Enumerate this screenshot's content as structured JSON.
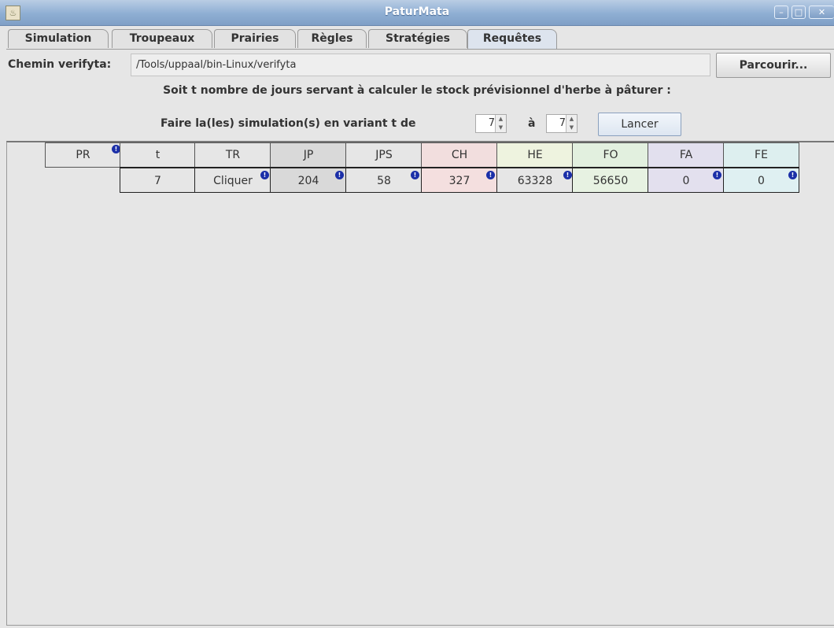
{
  "window": {
    "title": "PaturMata"
  },
  "tabs": [
    "Simulation",
    "Troupeaux",
    "Prairies",
    "Règles",
    "Stratégies",
    "Requêtes"
  ],
  "path": {
    "label": "Chemin verifyta:",
    "value": "/Tools/uppaal/bin-Linux/verifyta",
    "browse": "Parcourir..."
  },
  "info": "Soit t nombre de jours servant à calculer le stock prévisionnel d'herbe à pâturer :",
  "sim": {
    "label": "Faire la(les) simulation(s) en variant t de",
    "from": "7",
    "to_label": "à",
    "to": "7",
    "run": "Lancer"
  },
  "table": {
    "headers": [
      "PR",
      "t",
      "TR",
      "JP",
      "JPS",
      "CH",
      "HE",
      "FO",
      "FA",
      "FE"
    ],
    "row": [
      "",
      "7",
      "Cliquer",
      "204",
      "58",
      "327",
      "63328",
      "56650",
      "0",
      "0"
    ]
  },
  "colors": {
    "header": {
      "JP": "#d9d9d9",
      "CH": "#f2dede",
      "HE": "#eef3df",
      "FO": "#e2f0df",
      "FA": "#e2e0ee",
      "FE": "#ddefef"
    },
    "row": {
      "JP": "#d9d9d9",
      "CH": "#f4dfdf",
      "FO": "#e7f2e2",
      "FA": "#e3e0ee",
      "FE": "#dff0f2"
    }
  }
}
